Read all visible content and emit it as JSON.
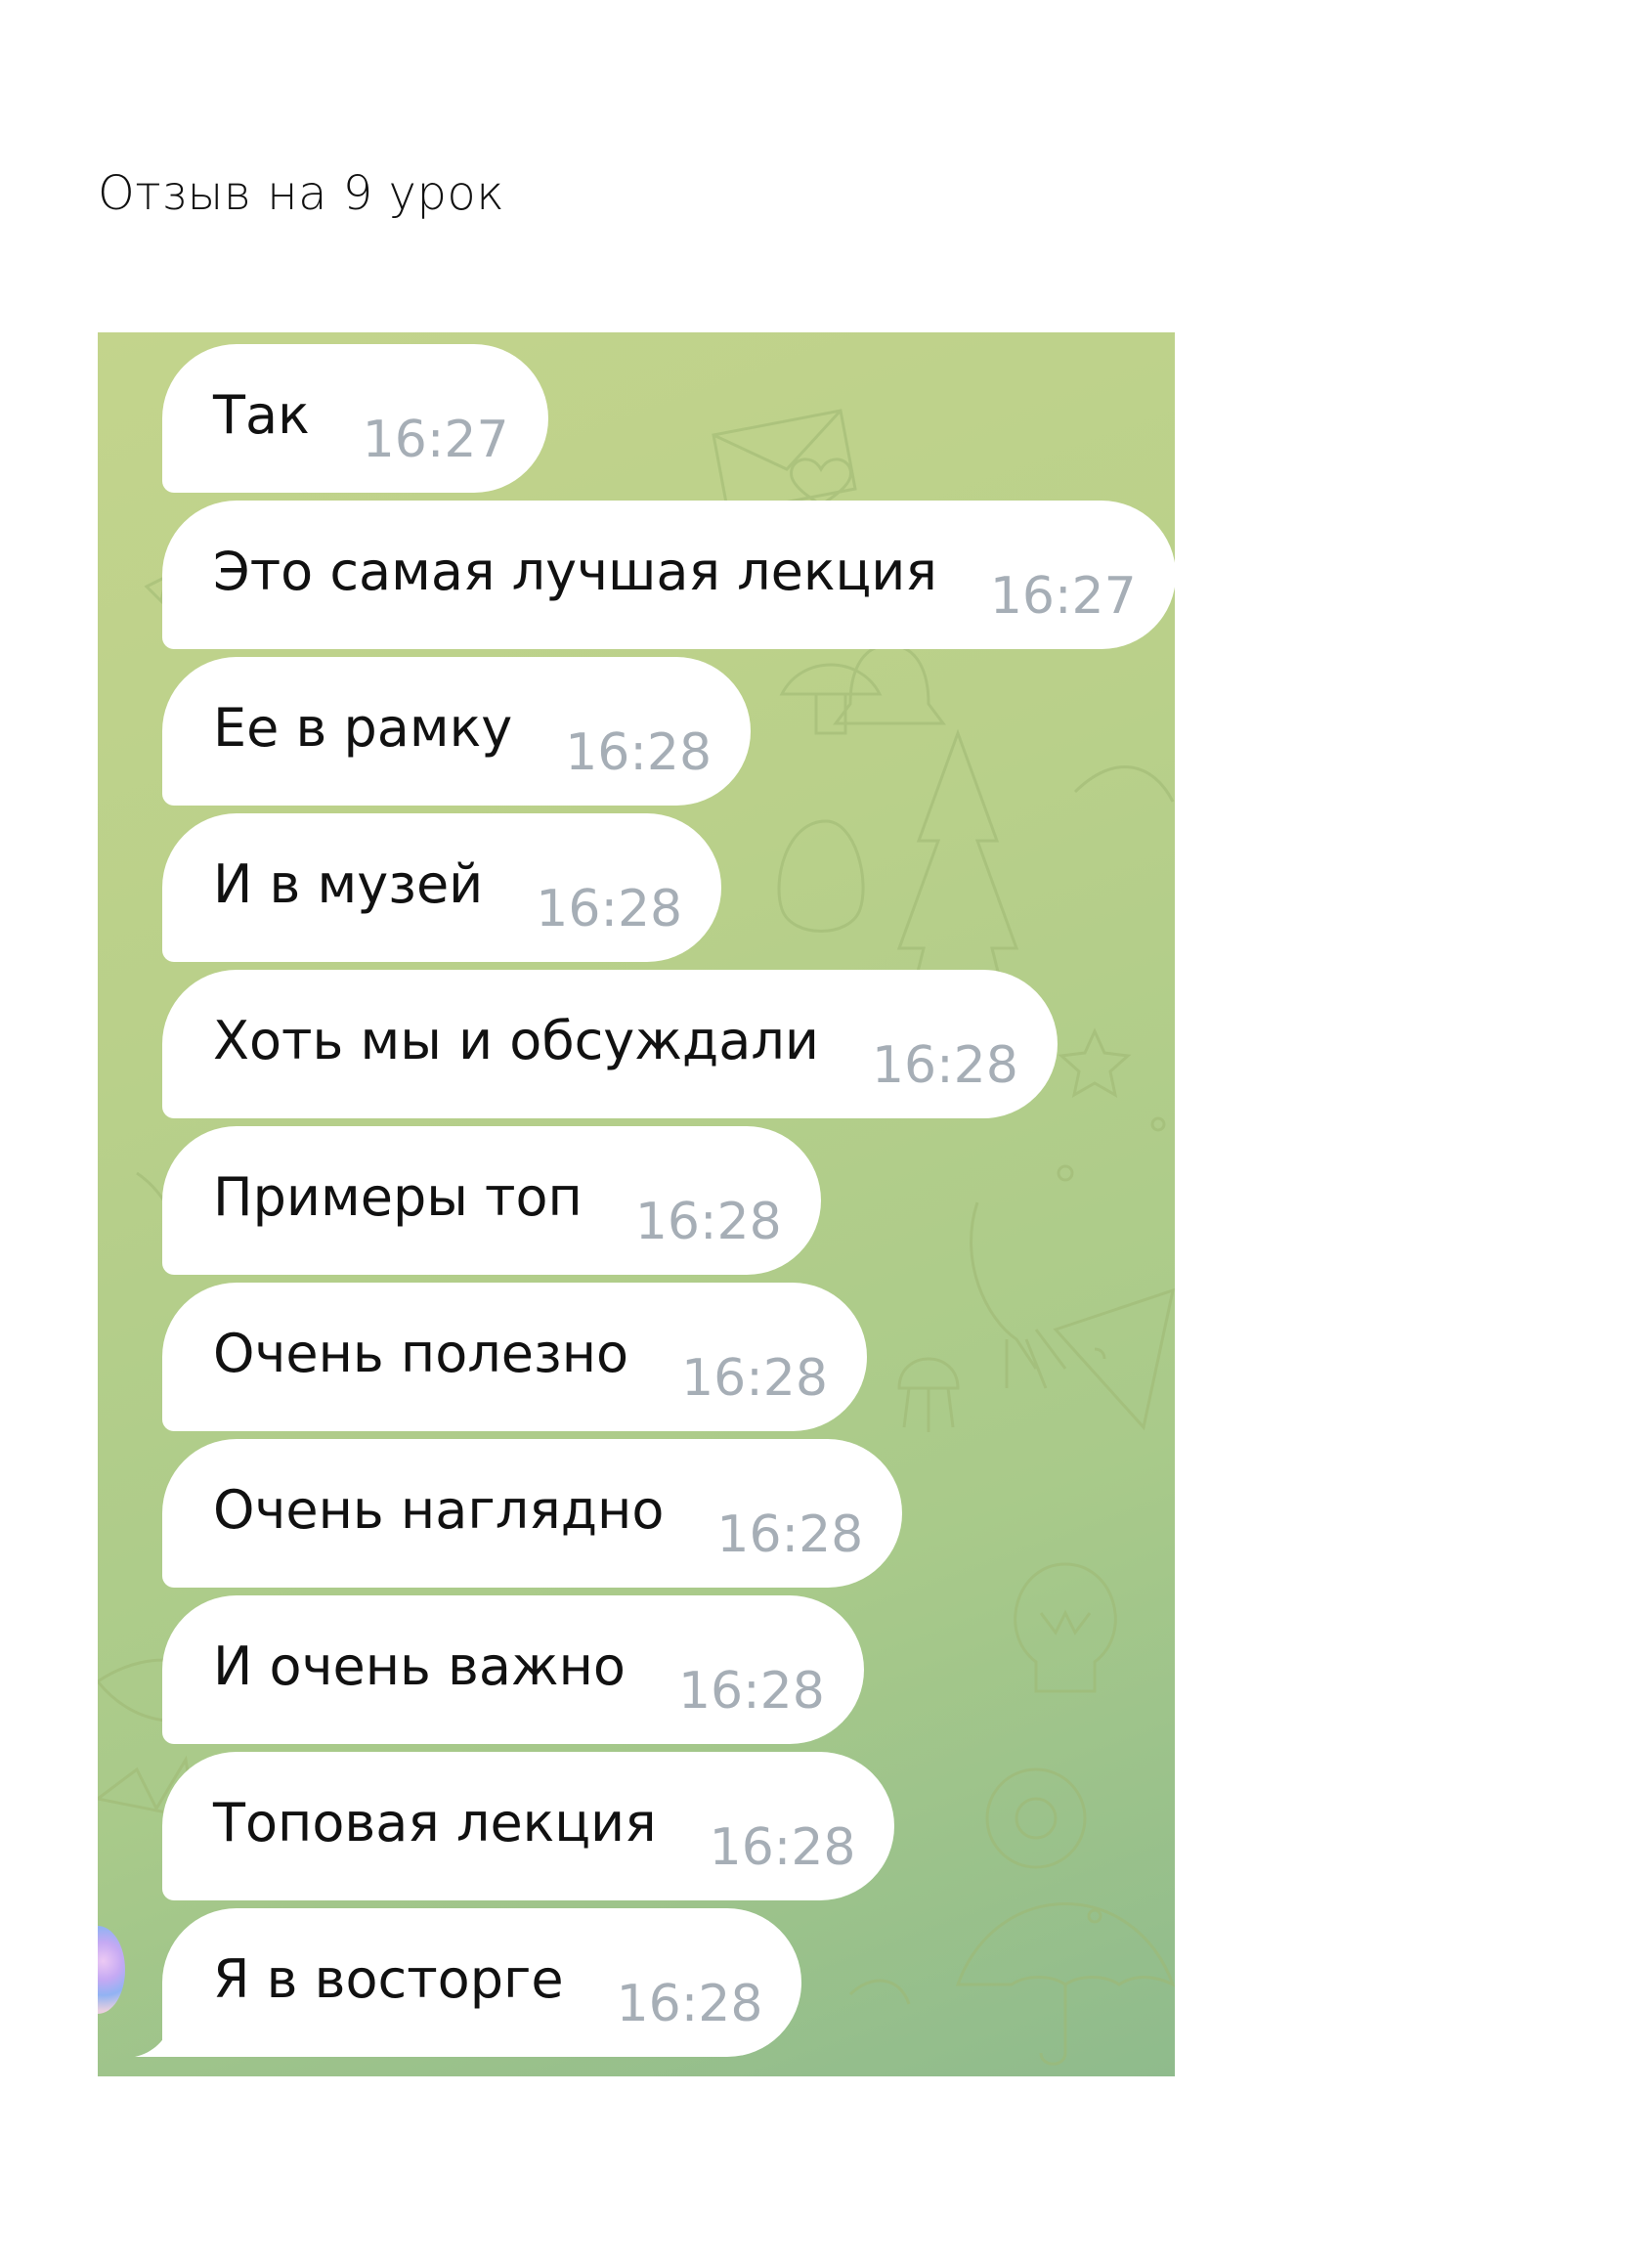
{
  "page": {
    "heading": "Отзыв на 9 урок"
  },
  "chat": {
    "messages": [
      {
        "text": "Так",
        "time": "16:27"
      },
      {
        "text": "Это самая лучшая лекция",
        "time": "16:27"
      },
      {
        "text": "Ее в рамку",
        "time": "16:28"
      },
      {
        "text": "И в музей",
        "time": "16:28"
      },
      {
        "text": "Хоть мы и обсуждали",
        "time": "16:28"
      },
      {
        "text": "Примеры топ",
        "time": "16:28"
      },
      {
        "text": "Очень полезно",
        "time": "16:28"
      },
      {
        "text": "Очень наглядно",
        "time": "16:28"
      },
      {
        "text": "И очень важно",
        "time": "16:28"
      },
      {
        "text": "Топовая лекция",
        "time": "16:28"
      },
      {
        "text": "Я в восторге",
        "time": "16:28"
      }
    ],
    "colors": {
      "wallpaper_top": "#c3d48c",
      "wallpaper_bottom": "#8fbb8c",
      "bubble": "#ffffff",
      "message_text": "#111111",
      "timestamp": "#a6aeb6"
    }
  }
}
